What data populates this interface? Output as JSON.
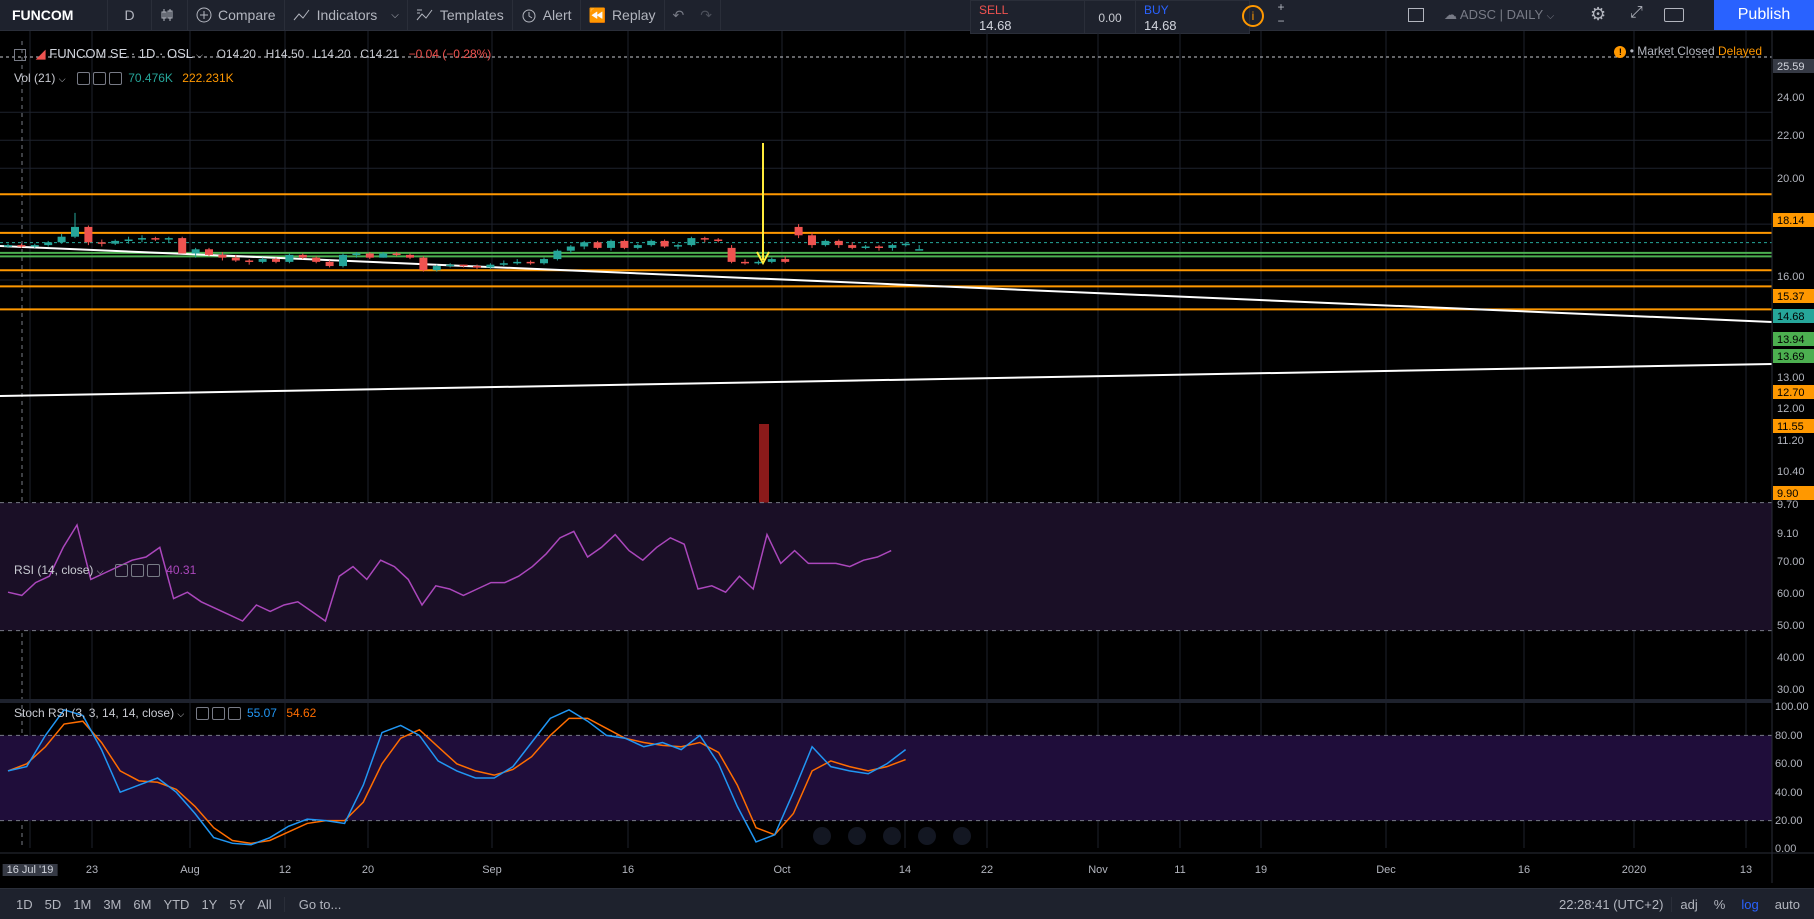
{
  "toolbar": {
    "symbol": "FUNCOM",
    "interval": "D",
    "compare": "Compare",
    "indicators": "Indicators",
    "templates": "Templates",
    "alert": "Alert",
    "replay": "Replay",
    "sell_label": "SELL",
    "sell_price": "14.68",
    "spread": "0.00",
    "buy_label": "BUY",
    "buy_price": "14.68",
    "layout_name": "ADSC | DAILY",
    "publish": "Publish"
  },
  "header": {
    "title": "FUNCOM SE · 1D · OSL",
    "open": "O14.20",
    "high": "H14.50",
    "low": "L14.20",
    "close": "C14.21",
    "change": "−0.04 (−0.28%)",
    "market_status": "Market Closed",
    "delayed": "Delayed"
  },
  "volume_legend": {
    "name": "Vol (21)",
    "v1": "70.476K",
    "v2": "222.231K"
  },
  "rsi_legend": {
    "name": "RSI (14, close)",
    "value": "40.31"
  },
  "stoch_legend": {
    "name": "Stoch RSI (3, 3, 14, 14, close)",
    "k": "55.07",
    "d": "54.62"
  },
  "price_axis": [
    "25.59",
    "24.00",
    "22.00",
    "20.00",
    "18.14",
    "16.00",
    "15.37",
    "14.68",
    "13.94",
    "13.69",
    "13.00",
    "12.70",
    "12.00",
    "11.55",
    "11.20",
    "10.40",
    "9.90",
    "9.70",
    "9.10"
  ],
  "rsi_axis": [
    "70.00",
    "60.00",
    "50.00",
    "40.00",
    "30.00"
  ],
  "stoch_axis": [
    "100.00",
    "80.00",
    "60.00",
    "40.00",
    "20.00",
    "0.00"
  ],
  "time_axis": [
    "16 Jul '19",
    "23",
    "Aug",
    "12",
    "20",
    "Sep",
    "16",
    "Oct",
    "14",
    "22",
    "Nov",
    "11",
    "19",
    "Dec",
    "16",
    "2020",
    "13"
  ],
  "bottom_bar": {
    "ranges": [
      "1D",
      "5D",
      "1M",
      "3M",
      "6M",
      "YTD",
      "1Y",
      "5Y",
      "All"
    ],
    "goto": "Go to...",
    "clock": "22:28:41 (UTC+2)",
    "adj": "adj",
    "pct": "%",
    "log": "log",
    "auto": "auto"
  },
  "colors": {
    "up": "#26a69a",
    "down": "#ef5350",
    "orange": "#ff9800",
    "rsi": "#ab47bc",
    "stoch_k": "#2196f3",
    "stoch_d": "#ff6d00",
    "accent": "#2962ff"
  },
  "chart_data": {
    "type": "candlestick",
    "horizontal_levels": [
      18.14,
      15.37,
      13.94,
      13.69,
      12.7,
      11.55,
      9.9
    ],
    "candles": [
      [
        14.4,
        14.6,
        14.3,
        14.5
      ],
      [
        14.5,
        14.6,
        14.3,
        14.4
      ],
      [
        14.4,
        14.6,
        14.3,
        14.5
      ],
      [
        14.5,
        14.8,
        14.4,
        14.7
      ],
      [
        14.7,
        15.3,
        14.6,
        15.1
      ],
      [
        15.1,
        16.8,
        15,
        15.8
      ],
      [
        15.8,
        15.9,
        14.5,
        14.7
      ],
      [
        14.7,
        14.9,
        14.4,
        14.6
      ],
      [
        14.6,
        14.9,
        14.5,
        14.8
      ],
      [
        14.8,
        15.1,
        14.6,
        14.9
      ],
      [
        14.9,
        15.2,
        14.7,
        15
      ],
      [
        15,
        15.1,
        14.8,
        14.9
      ],
      [
        14.9,
        15.1,
        14.7,
        15
      ],
      [
        15,
        15.1,
        13.9,
        13.9
      ],
      [
        13.9,
        14.3,
        13.6,
        14.2
      ],
      [
        14.2,
        14.3,
        13.7,
        13.8
      ],
      [
        13.8,
        14,
        13.4,
        13.6
      ],
      [
        13.6,
        13.8,
        13.3,
        13.4
      ],
      [
        13.4,
        13.5,
        13.1,
        13.3
      ],
      [
        13.3,
        13.6,
        13.2,
        13.5
      ],
      [
        13.5,
        13.6,
        13.2,
        13.3
      ],
      [
        13.3,
        13.9,
        13.2,
        13.8
      ],
      [
        13.8,
        13.9,
        13.5,
        13.6
      ],
      [
        13.6,
        13.7,
        13.2,
        13.3
      ],
      [
        13.3,
        13.4,
        12.9,
        13
      ],
      [
        13,
        13.9,
        12.9,
        13.8
      ],
      [
        13.8,
        14,
        13.6,
        13.9
      ],
      [
        13.9,
        14,
        13.5,
        13.6
      ],
      [
        13.6,
        14,
        13.6,
        13.9
      ],
      [
        13.9,
        14,
        13.7,
        13.8
      ],
      [
        13.8,
        13.9,
        13.5,
        13.6
      ],
      [
        13.6,
        13.7,
        12.6,
        12.7
      ],
      [
        12.7,
        13.1,
        12.6,
        13
      ],
      [
        13,
        13.2,
        12.9,
        13.1
      ],
      [
        13.1,
        13.1,
        12.9,
        13
      ],
      [
        13,
        13.1,
        12.8,
        12.9
      ],
      [
        12.9,
        13.2,
        12.8,
        13.1
      ],
      [
        13.1,
        13.4,
        13,
        13.2
      ],
      [
        13.2,
        13.5,
        13.1,
        13.3
      ],
      [
        13.3,
        13.4,
        13.1,
        13.2
      ],
      [
        13.2,
        13.6,
        13.1,
        13.5
      ],
      [
        13.5,
        14.2,
        13.4,
        14.1
      ],
      [
        14.1,
        14.5,
        13.9,
        14.4
      ],
      [
        14.4,
        14.8,
        14.2,
        14.7
      ],
      [
        14.7,
        14.8,
        14.2,
        14.3
      ],
      [
        14.3,
        14.9,
        14.1,
        14.8
      ],
      [
        14.8,
        14.9,
        14.2,
        14.3
      ],
      [
        14.3,
        14.6,
        14.2,
        14.5
      ],
      [
        14.5,
        14.9,
        14.4,
        14.8
      ],
      [
        14.8,
        14.9,
        14.3,
        14.4
      ],
      [
        14.4,
        14.6,
        14.2,
        14.5
      ],
      [
        14.5,
        15.1,
        14.4,
        15
      ],
      [
        15,
        15.1,
        14.7,
        14.9
      ],
      [
        14.9,
        15,
        14.7,
        14.8
      ],
      [
        14.3,
        14.5,
        13.2,
        13.3
      ],
      [
        13.3,
        13.5,
        13.1,
        13.2
      ],
      [
        13.2,
        13.4,
        13.1,
        13.3
      ],
      [
        13.3,
        13.6,
        13.2,
        13.5
      ],
      [
        13.5,
        13.7,
        13.2,
        13.3
      ],
      [
        15.8,
        16,
        15,
        15.2
      ],
      [
        15.2,
        15.4,
        14.3,
        14.5
      ],
      [
        14.5,
        14.9,
        14.4,
        14.8
      ],
      [
        14.8,
        14.9,
        14.3,
        14.5
      ],
      [
        14.5,
        14.7,
        14.2,
        14.3
      ],
      [
        14.3,
        14.5,
        14.2,
        14.4
      ],
      [
        14.4,
        14.5,
        14.1,
        14.3
      ],
      [
        14.3,
        14.6,
        14.1,
        14.5
      ],
      [
        14.5,
        14.7,
        14.4,
        14.6
      ],
      [
        14.2,
        14.5,
        14.2,
        14.21
      ]
    ],
    "rsi": [
      42,
      41,
      45,
      47,
      56,
      63,
      46,
      48,
      50,
      52,
      53,
      56,
      40,
      42,
      39,
      37,
      35,
      33,
      38,
      36,
      38,
      39,
      36,
      33,
      47,
      50,
      46,
      52,
      50,
      46,
      38,
      44,
      43,
      41,
      43,
      45,
      45,
      47,
      50,
      54,
      59,
      61,
      53,
      56,
      60,
      55,
      52,
      56,
      59,
      57,
      43,
      44,
      42,
      47,
      43,
      60,
      51,
      55,
      51,
      51,
      51,
      50,
      52,
      53,
      55
    ],
    "stoch_k": [
      55,
      58,
      80,
      98,
      94,
      70,
      40,
      45,
      50,
      40,
      25,
      8,
      4,
      3,
      8,
      16,
      21,
      20,
      18,
      45,
      82,
      87,
      80,
      62,
      55,
      50,
      50,
      58,
      75,
      92,
      98,
      90,
      80,
      78,
      72,
      75,
      70,
      80,
      60,
      30,
      5,
      10,
      40,
      72,
      58,
      55,
      53,
      60,
      70
    ],
    "stoch_d": [
      55,
      60,
      72,
      88,
      90,
      75,
      55,
      48,
      47,
      42,
      30,
      15,
      6,
      4,
      6,
      12,
      18,
      20,
      20,
      33,
      60,
      78,
      84,
      72,
      60,
      55,
      52,
      56,
      65,
      80,
      92,
      92,
      85,
      78,
      75,
      73,
      72,
      75,
      68,
      45,
      15,
      10,
      25,
      55,
      62,
      58,
      55,
      58,
      63
    ]
  }
}
